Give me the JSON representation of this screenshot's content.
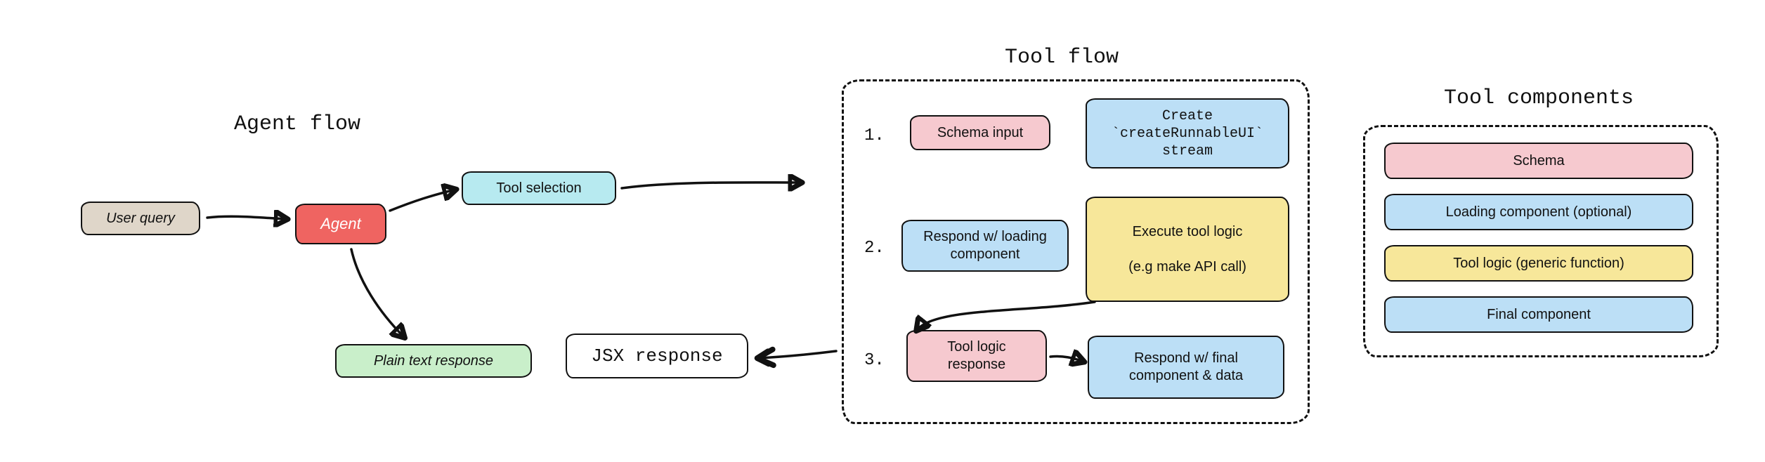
{
  "sections": {
    "agent_flow": {
      "title": "Agent flow"
    },
    "tool_flow": {
      "title": "Tool flow"
    },
    "tool_components": {
      "title": "Tool components"
    }
  },
  "agent_flow": {
    "user_query": "User query",
    "agent": "Agent",
    "tool_selection": "Tool selection",
    "plain_text_response": "Plain text response",
    "jsx_response": "JSX response"
  },
  "tool_flow": {
    "steps": {
      "one": "1.",
      "two": "2.",
      "three": "3."
    },
    "schema_input": "Schema input",
    "create_runnable_ui": "Create `createRunnableUI` stream",
    "respond_loading": "Respond w/ loading component",
    "execute_tool_logic": "Execute tool logic\n\n(e.g make API call)",
    "tool_logic_response": "Tool logic response",
    "respond_final": "Respond w/ final component & data"
  },
  "tool_components": {
    "schema": "Schema",
    "loading": "Loading component (optional)",
    "tool_logic": "Tool logic (generic function)",
    "final": "Final component"
  },
  "colors": {
    "tan": "#dfd6c9",
    "red": "#ef6461",
    "cyan": "#b7eaf0",
    "green": "#c9efca",
    "pink": "#f6c9cf",
    "blue": "#bcdff6",
    "yellow": "#f7e79a"
  }
}
